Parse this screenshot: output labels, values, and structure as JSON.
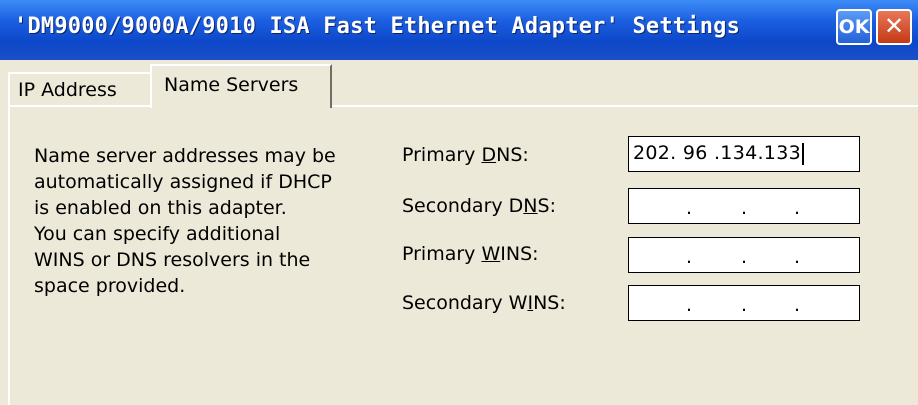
{
  "window": {
    "title": "'DM9000/9000A/9010 ISA Fast Ethernet Adapter' Settings",
    "ok_label": "OK",
    "close_label": "✕"
  },
  "tabs": [
    {
      "label": "IP Address",
      "active": false
    },
    {
      "label": "Name Servers",
      "active": true
    }
  ],
  "description_lines": [
    "Name server addresses may be",
    "automatically assigned if DHCP",
    "is enabled on this adapter.",
    "You can specify additional",
    "WINS or DNS resolvers in the",
    "space provided."
  ],
  "fields": {
    "primary_dns": {
      "label_pre": "Primary ",
      "label_key": "D",
      "label_post": "NS:",
      "value": "202. 96 .134.133"
    },
    "secondary_dns": {
      "label_pre": "Secondary D",
      "label_key": "N",
      "label_post": "S:",
      "value": ""
    },
    "primary_wins": {
      "label_pre": "Primary ",
      "label_key": "W",
      "label_post": "INS:",
      "value": ""
    },
    "secondary_wins": {
      "label_pre": "Secondary W",
      "label_key": "I",
      "label_post": "NS:",
      "value": ""
    }
  },
  "ip_separator": "."
}
